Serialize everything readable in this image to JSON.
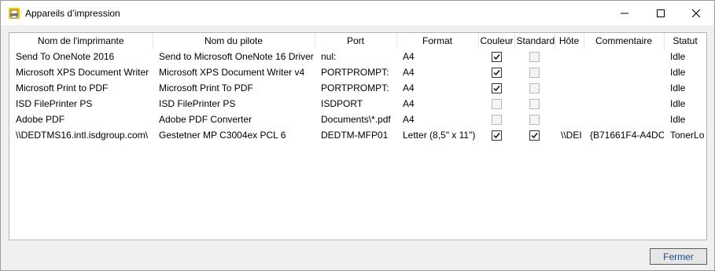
{
  "window": {
    "title": "Appareils d’impression"
  },
  "table": {
    "columns": [
      "Nom de l'imprimante",
      "Nom du pilote",
      "Port",
      "Format",
      "Couleur",
      "Standard",
      "Hôte",
      "Commentaire",
      "Statut"
    ],
    "rows": [
      {
        "name": "Send To OneNote 2016",
        "driver": "Send to Microsoft OneNote 16 Driver",
        "port": "nul:",
        "format": "A4",
        "color": true,
        "standard": false,
        "host": "",
        "comment": "",
        "status": "Idle"
      },
      {
        "name": "Microsoft XPS Document Writer",
        "driver": "Microsoft XPS Document Writer v4",
        "port": "PORTPROMPT:",
        "format": "A4",
        "color": true,
        "standard": false,
        "host": "",
        "comment": "",
        "status": "Idle"
      },
      {
        "name": "Microsoft Print to PDF",
        "driver": "Microsoft Print To PDF",
        "port": "PORTPROMPT:",
        "format": "A4",
        "color": true,
        "standard": false,
        "host": "",
        "comment": "",
        "status": "Idle"
      },
      {
        "name": "ISD FilePrinter PS",
        "driver": "ISD FilePrinter PS",
        "port": "ISDPORT",
        "format": "A4",
        "color": false,
        "standard": false,
        "host": "",
        "comment": "",
        "status": "Idle"
      },
      {
        "name": "Adobe PDF",
        "driver": "Adobe PDF Converter",
        "port": "Documents\\*.pdf",
        "format": "A4",
        "color": false,
        "standard": false,
        "host": "",
        "comment": "",
        "status": "Idle"
      },
      {
        "name": "\\\\DEDTMS16.intl.isdgroup.com\\",
        "driver": "Gestetner MP C3004ex PCL 6",
        "port": "DEDTM-MFP01",
        "format": "Letter (8,5\" x 11\")",
        "color": true,
        "standard": true,
        "host": "\\\\DEI",
        "comment": "{B71661F4-A4DC",
        "status": "TonerLo"
      }
    ]
  },
  "footer": {
    "close_label": "Fermer"
  }
}
